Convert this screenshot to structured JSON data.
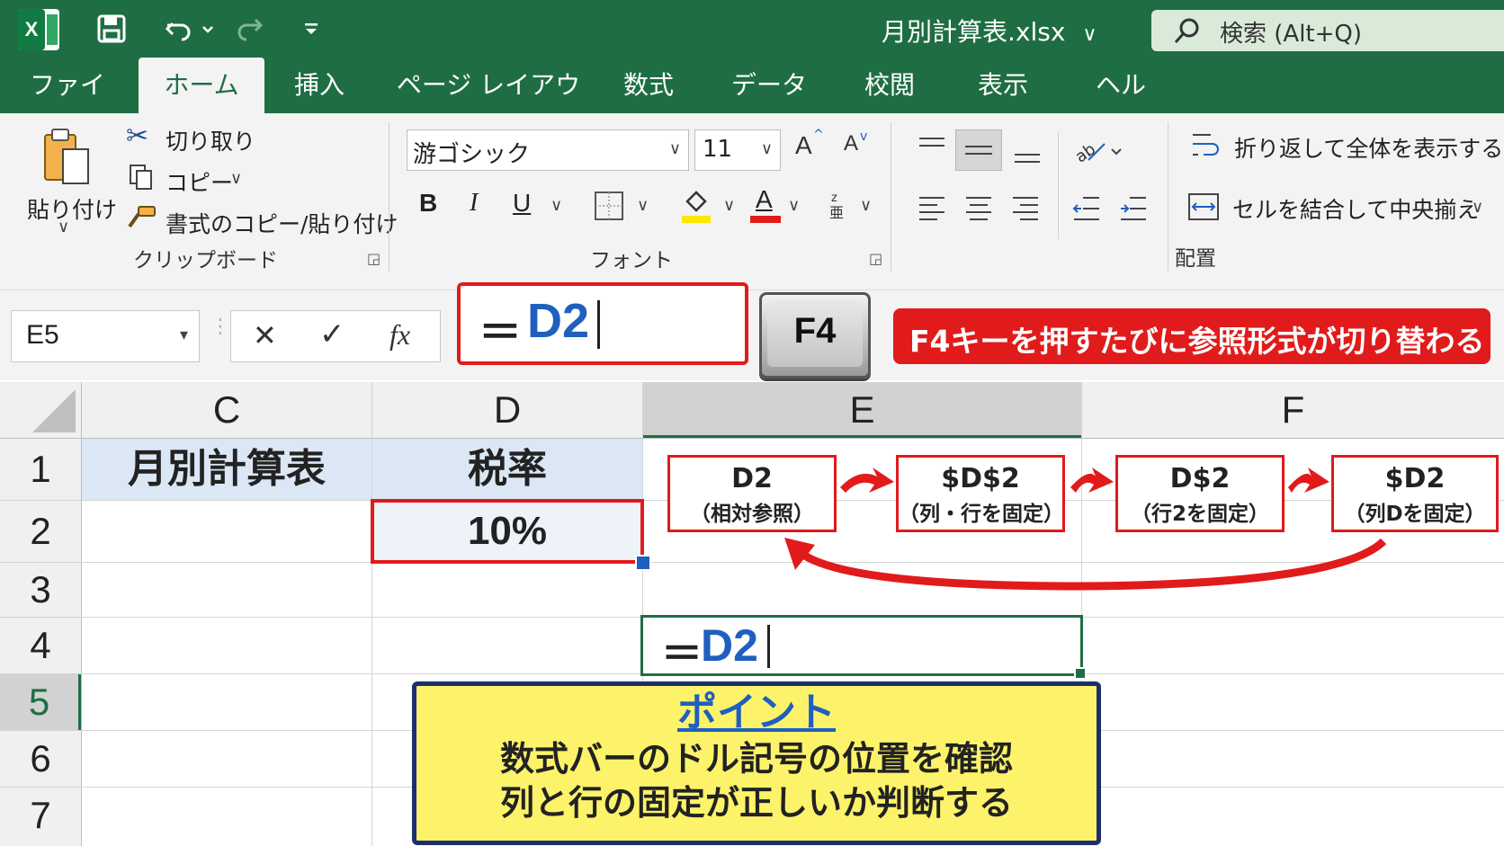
{
  "title_bar": {
    "app_icon": "excel-x-icon",
    "filename": "月別計算表.xlsx",
    "search_placeholder": "検索 (Alt+Q)"
  },
  "tabs": [
    "ファイル",
    "ホーム",
    "挿入",
    "ページ レイアウト",
    "数式",
    "データ",
    "校閲",
    "表示",
    "ヘルプ"
  ],
  "active_tab": "ホーム",
  "ribbon": {
    "clipboard": {
      "paste_label": "貼り付け",
      "cut_label": "切り取り",
      "copy_label": "コピー",
      "format_painter_label": "書式のコピー/貼り付け",
      "group_label": "クリップボード"
    },
    "font": {
      "font_name": "游ゴシック",
      "font_size": "11",
      "bold": "B",
      "italic": "I",
      "underline": "U",
      "font_color_letter": "A",
      "grow_letter": "A",
      "shrink_letter": "A",
      "group_label": "フォント"
    },
    "alignment": {
      "wrap_label": "折り返して全体を表示する",
      "merge_label": "セルを結合して中央揃え",
      "group_label": "配置"
    }
  },
  "formula_bar": {
    "name_box": "E5",
    "cancel": "✕",
    "enter": "✓",
    "fx": "fx",
    "formula_prefix": "＝",
    "formula_ref": "D2"
  },
  "f4_key": "F4",
  "callout_text": "F4キーを押すたびに参照形式が切り替わる",
  "columns": [
    "C",
    "D",
    "E",
    "F"
  ],
  "rows": [
    "1",
    "2",
    "3",
    "4",
    "5",
    "6",
    "7"
  ],
  "cells": {
    "C1": "月別計算表",
    "D1": "税率",
    "D2": "10%",
    "E4_prefix": "＝",
    "E4_ref": "D2"
  },
  "cycle_steps": [
    {
      "ref": "D2",
      "desc": "（相対参照）"
    },
    {
      "ref": "$D$2",
      "desc": "（列・行を固定）"
    },
    {
      "ref": "D$2",
      "desc": "（行2を固定）"
    },
    {
      "ref": "$D2",
      "desc": "（列Dを固定）"
    }
  ],
  "point_box": {
    "title": "ポイント",
    "line1": "数式バーのドル記号の位置を確認",
    "line2": "列と行の固定が正しいか判断する"
  },
  "colors": {
    "excel_green": "#1f6e43",
    "highlight_red": "#e11b1b",
    "ref_blue": "#1f5fbf",
    "point_yellow": "#fdf36a",
    "point_border": "#1b2f6b"
  }
}
